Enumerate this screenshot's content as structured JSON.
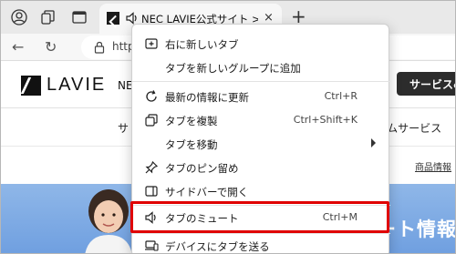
{
  "tab": {
    "title": "NEC LAVIE公式サイト > サービス",
    "close": "×"
  },
  "tabstrip": {
    "new_tab": "+"
  },
  "toolbar": {
    "back": "←",
    "refresh": "↻",
    "address": "http"
  },
  "page": {
    "logo_text": "LAVIE",
    "nec_text": "NEC",
    "service_button": "サービス&",
    "nav_left": "サ",
    "nav_right": "アムサービス",
    "small_link": "商品情報",
    "hero_text": "ート情報"
  },
  "menu": {
    "items": [
      {
        "label": "右に新しいタブ",
        "shortcut": "",
        "icon": "new-tab-right-icon"
      },
      {
        "label": "タブを新しいグループに追加",
        "shortcut": "",
        "icon": ""
      },
      {
        "label": "最新の情報に更新",
        "shortcut": "Ctrl+R",
        "icon": "refresh-icon"
      },
      {
        "label": "タブを複製",
        "shortcut": "Ctrl+Shift+K",
        "icon": "duplicate-icon"
      },
      {
        "label": "タブを移動",
        "shortcut": "",
        "icon": ""
      },
      {
        "label": "タブのピン留め",
        "shortcut": "",
        "icon": "pin-icon"
      },
      {
        "label": "サイドバーで開く",
        "shortcut": "",
        "icon": "sidebar-icon"
      },
      {
        "label": "タブのミュート",
        "shortcut": "Ctrl+M",
        "icon": "speaker-icon"
      },
      {
        "label": "デバイスにタブを送る",
        "shortcut": "",
        "icon": "device-icon"
      }
    ]
  },
  "colors": {
    "highlight": "#e00000",
    "hero": "#7aa6e2"
  }
}
